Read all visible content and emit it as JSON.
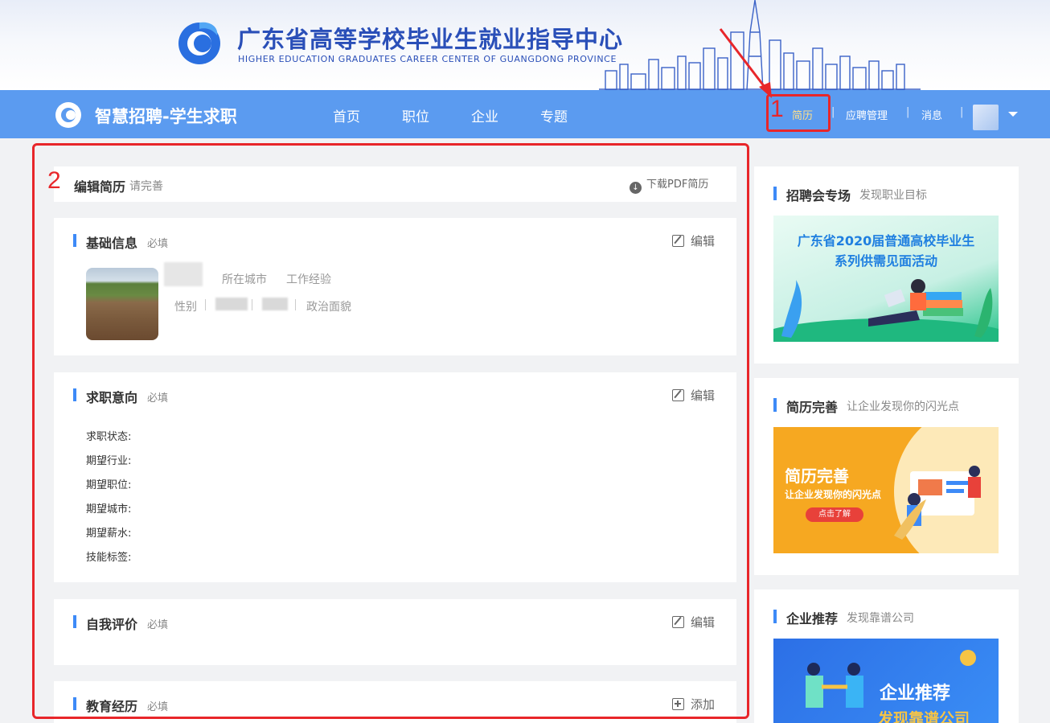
{
  "banner": {
    "title": "广东省高等学校毕业生就业指导中心",
    "subtitle": "HIGHER EDUCATION GRADUATES CAREER CENTER OF GUANGDONG PROVINCE"
  },
  "nav": {
    "brand": "智慧招聘-学生求职",
    "links": [
      "首页",
      "职位",
      "企业",
      "专题"
    ],
    "right": {
      "resume": "简历",
      "applications": "应聘管理",
      "messages": "消息",
      "separator": "|"
    }
  },
  "annotations": {
    "one": "1",
    "two": "2"
  },
  "resume": {
    "header_title": "编辑简历",
    "header_note": "请完善",
    "download_pdf": "下载PDF简历",
    "sections": {
      "basic": {
        "title": "基础信息",
        "required": "必填",
        "action": "编辑",
        "city_label": "所在城市",
        "experience_label": "工作经验",
        "gender_label": "性别",
        "politics_label": "政治面貌"
      },
      "intention": {
        "title": "求职意向",
        "required": "必填",
        "action": "编辑",
        "fields": [
          "求职状态:",
          "期望行业:",
          "期望职位:",
          "期望城市:",
          "期望薪水:",
          "技能标签:"
        ]
      },
      "self": {
        "title": "自我评价",
        "required": "必填",
        "action": "编辑"
      },
      "education": {
        "title": "教育经历",
        "required": "必填",
        "action": "添加"
      }
    }
  },
  "sidebar": {
    "job_fair": {
      "title": "招聘会专场",
      "subtitle": "发现职业目标",
      "banner_line1": "广东省2020届普通高校毕业生",
      "banner_line2": "系列供需见面活动"
    },
    "resume_improve": {
      "title": "简历完善",
      "subtitle": "让企业发现你的闪光点",
      "banner_title": "简历完善",
      "banner_sub": "让企业发现你的闪光点",
      "banner_button": "点击了解"
    },
    "company": {
      "title": "企业推荐",
      "subtitle": "发现靠谱公司",
      "banner_title": "企业推荐",
      "banner_sub": "发现靠谱公司"
    }
  }
}
